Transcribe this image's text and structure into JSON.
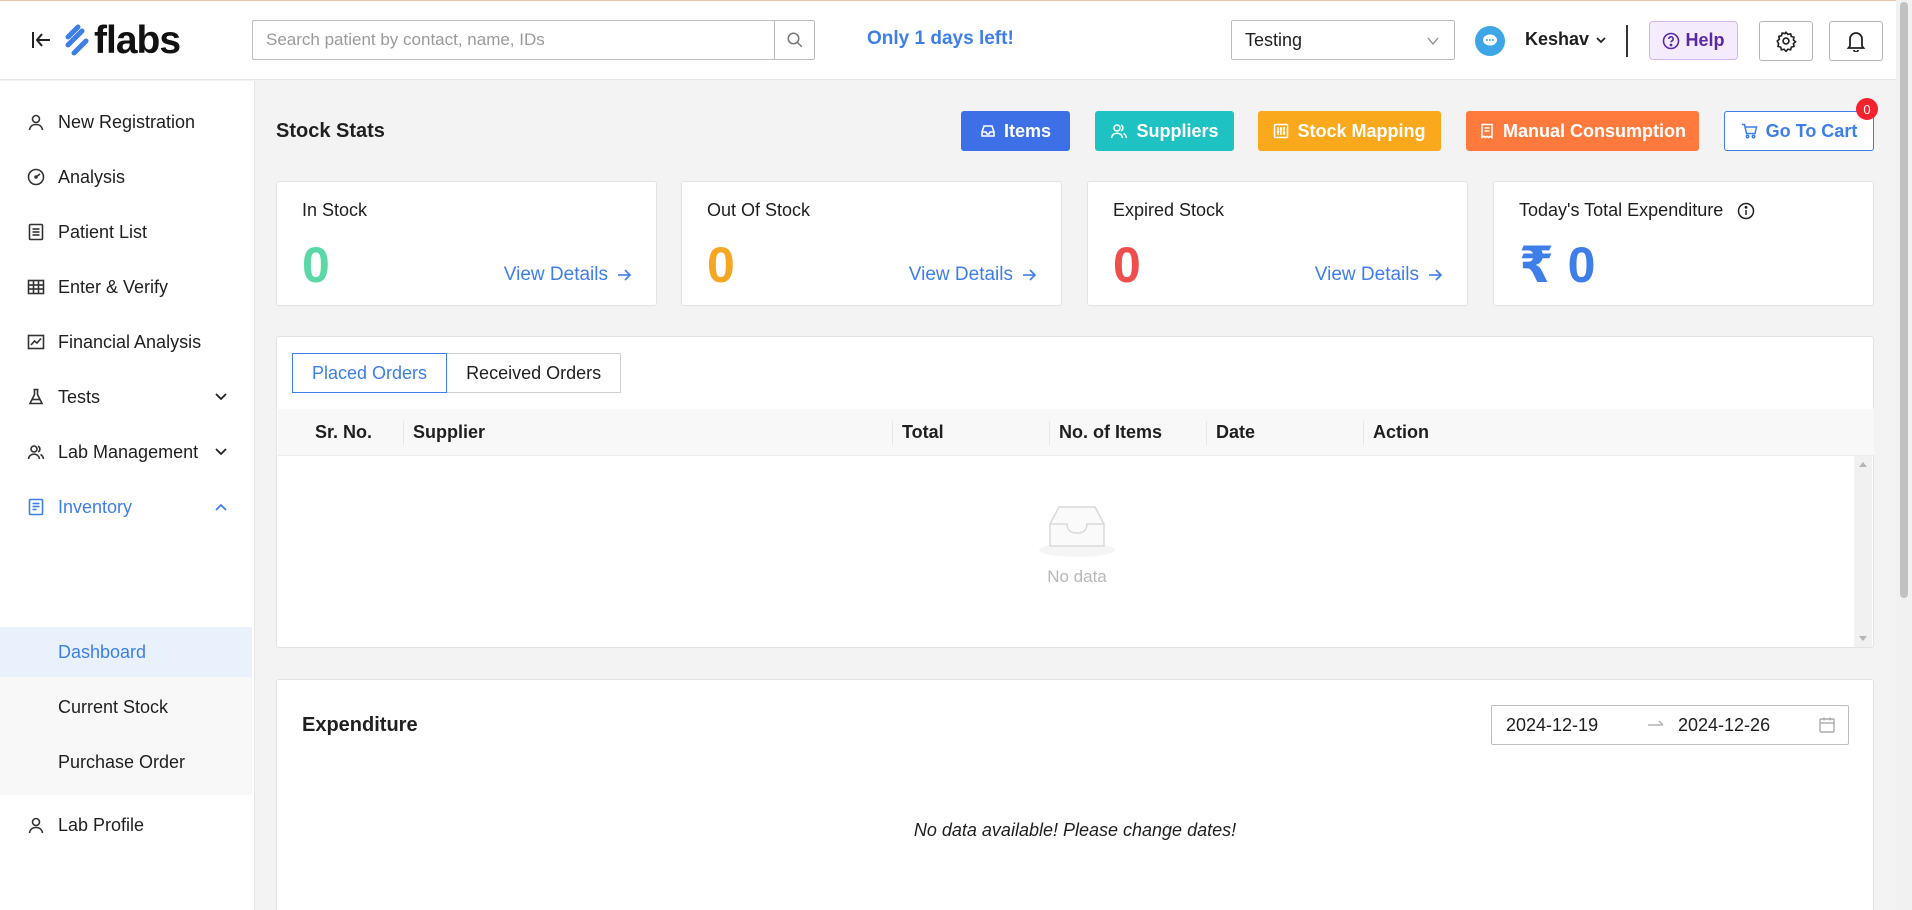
{
  "header": {
    "logo_text": "flabs",
    "search_placeholder": "Search patient by contact, name, IDs",
    "days_left": "Only 1 days left!",
    "lab_select": "Testing",
    "user_name": "Keshav",
    "help_label": "Help"
  },
  "sidebar": {
    "items": [
      {
        "label": "New Registration",
        "icon": "user-icon"
      },
      {
        "label": "Analysis",
        "icon": "gauge-icon"
      },
      {
        "label": "Patient List",
        "icon": "list-icon"
      },
      {
        "label": "Enter & Verify",
        "icon": "table-icon"
      },
      {
        "label": "Financial Analysis",
        "icon": "chart-icon"
      },
      {
        "label": "Tests",
        "icon": "flask-icon"
      },
      {
        "label": "Lab Management",
        "icon": "users-icon"
      },
      {
        "label": "Inventory",
        "icon": "inventory-icon"
      },
      {
        "label": "Lab Profile",
        "icon": "user-icon"
      }
    ],
    "inventory_submenu": [
      "Dashboard",
      "Current Stock",
      "Purchase Order"
    ]
  },
  "main": {
    "title": "Stock Stats",
    "buttons": {
      "items": "Items",
      "suppliers": "Suppliers",
      "stock_mapping": "Stock Mapping",
      "manual_consumption": "Manual Consumption",
      "go_to_cart": "Go To Cart",
      "cart_count": "0"
    },
    "stats": [
      {
        "label": "In Stock",
        "value": "0",
        "details": "View Details",
        "color": "#5ad8a6"
      },
      {
        "label": "Out Of Stock",
        "value": "0",
        "details": "View Details",
        "color": "#f5a623"
      },
      {
        "label": "Expired Stock",
        "value": "0",
        "details": "View Details",
        "color": "#f04d4d"
      },
      {
        "label": "Today's Total Expenditure",
        "value": "₹ 0",
        "color": "#3d7ee9"
      }
    ],
    "orders": {
      "tabs": [
        "Placed Orders",
        "Received Orders"
      ],
      "columns": [
        "Sr. No.",
        "Supplier",
        "Total",
        "No. of Items",
        "Date",
        "Action"
      ],
      "empty_text": "No data"
    },
    "expenditure": {
      "title": "Expenditure",
      "start_date": "2024-12-19",
      "end_date": "2024-12-26",
      "no_data": "No data available! Please change dates!"
    }
  },
  "colors": {
    "accent": "#3d7ee9",
    "items_btn": "#3d6fe6",
    "suppliers_btn": "#1fc2c2",
    "stock_mapping_btn": "#faa91c",
    "manual_consumption_btn": "#ff7a3c"
  }
}
